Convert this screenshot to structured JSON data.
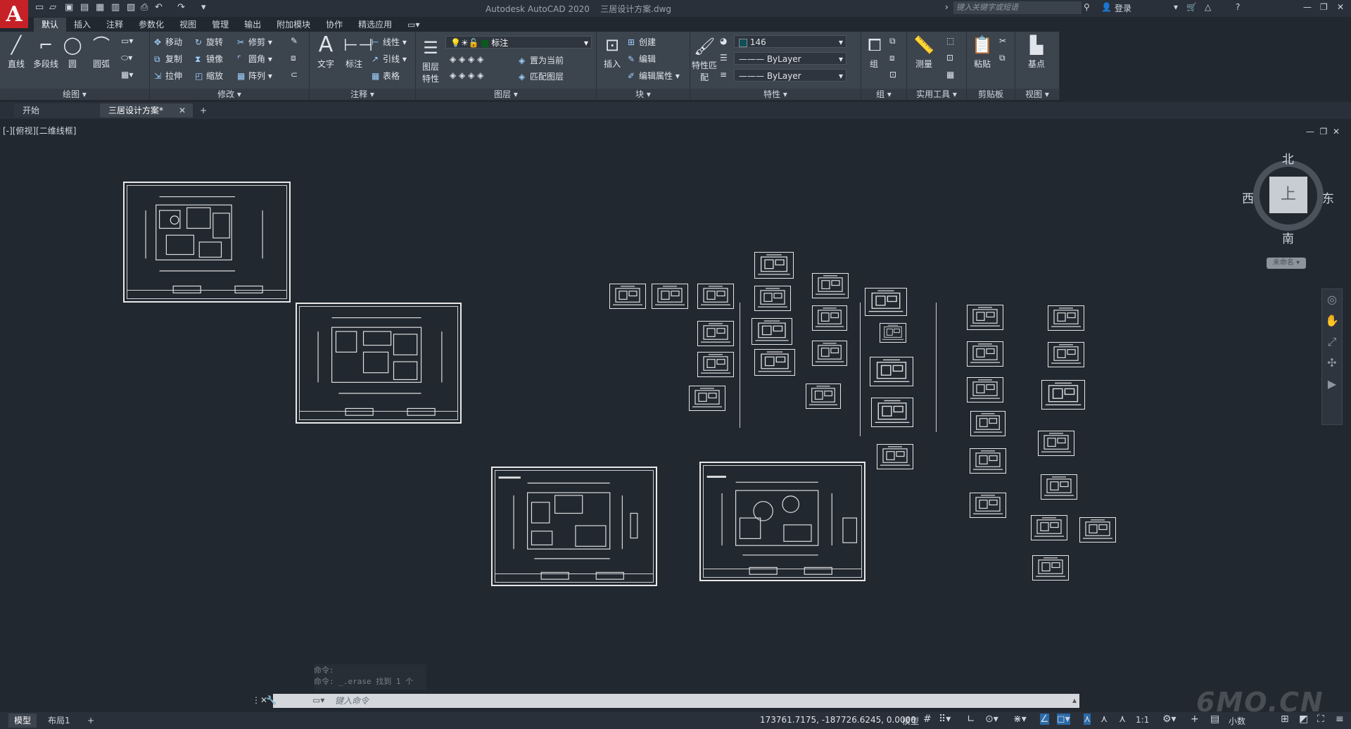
{
  "app": {
    "title": "Autodesk AutoCAD 2020",
    "file": "三居设计方案.dwg",
    "logo": "A"
  },
  "search_placeholder": "键入关键字或短语",
  "user": {
    "login": "登录"
  },
  "tabs": [
    "默认",
    "插入",
    "注释",
    "参数化",
    "视图",
    "管理",
    "输出",
    "附加模块",
    "协作",
    "精选应用"
  ],
  "ribbon": {
    "draw": {
      "label": "绘图",
      "line": "直线",
      "polyline": "多段线",
      "circle": "圆",
      "arc": "圆弧"
    },
    "modify": {
      "label": "修改",
      "move": "移动",
      "rotate": "旋转",
      "trim": "修剪",
      "copy": "复制",
      "mirror": "镜像",
      "fillet": "圆角",
      "stretch": "拉伸",
      "scale": "缩放",
      "array": "阵列"
    },
    "annotation": {
      "label": "注释",
      "text": "文字",
      "dim": "标注",
      "linetype": "线性",
      "leader": "引线",
      "table": "表格"
    },
    "layers": {
      "label": "图层",
      "props": "图层特性",
      "current_layer": "标注",
      "set_current": "置为当前",
      "match_layer": "匹配图层"
    },
    "block": {
      "label": "块",
      "insert": "插入",
      "create": "创建",
      "edit": "编辑",
      "edit_attr": "编辑属性"
    },
    "properties": {
      "label": "特性",
      "match": "特性匹配",
      "color": "146",
      "linetype": "ByLayer",
      "lineweight": "ByLayer"
    },
    "groups": {
      "label": "组",
      "group": "组"
    },
    "utilities": {
      "label": "实用工具",
      "measure": "测量"
    },
    "clipboard": {
      "label": "剪贴板",
      "paste": "粘贴"
    },
    "view": {
      "label": "视图",
      "base": "基点"
    }
  },
  "file_tabs": {
    "start": "开始",
    "current": "三居设计方案*",
    "add": "+"
  },
  "viewport": {
    "label": "[-][俯视][二维线框]"
  },
  "viewcube": {
    "north": "北",
    "south": "南",
    "east": "东",
    "west": "西",
    "top": "上",
    "wcs": "未命名"
  },
  "command": {
    "history1": "命令:",
    "history2": "命令: _.erase 找到 1 个",
    "placeholder": "键入命令"
  },
  "status": {
    "model_tab": "模型",
    "layout_tab": "布局1",
    "add": "+",
    "coords": "173761.7175, -187726.6245, 0.0000",
    "model_label": "模型",
    "scale": "1:1",
    "units": "小数"
  },
  "watermark": "6MO.CN"
}
